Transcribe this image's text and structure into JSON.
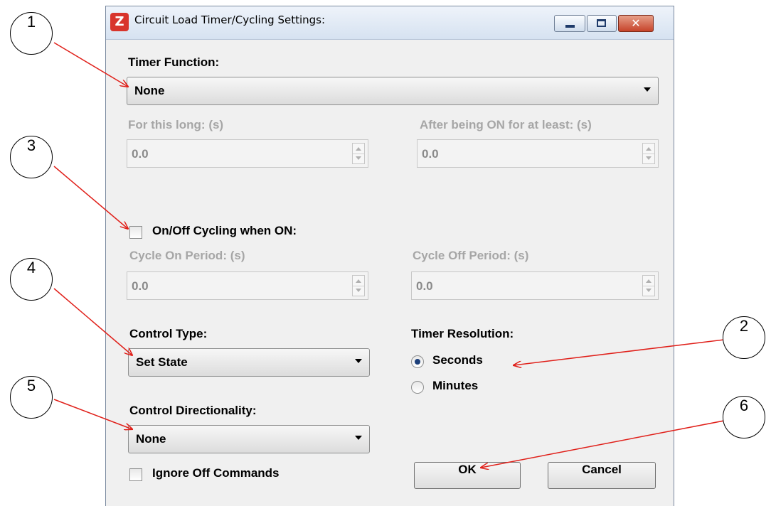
{
  "window": {
    "title": "Circuit Load Timer/Cycling Settings:",
    "app_icon": "Z",
    "controls": {
      "minimize": "minimize-icon",
      "maximize": "maximize-icon",
      "close": "✕"
    }
  },
  "timer_function": {
    "label": "Timer Function:",
    "value": "None"
  },
  "for_this_long": {
    "label": "For this long: (s)",
    "value": "0.0"
  },
  "after_on": {
    "label": "After being ON for at least: (s)",
    "value": "0.0"
  },
  "cycling": {
    "label": "On/Off Cycling when ON:",
    "checked": false
  },
  "cycle_on": {
    "label": "Cycle On Period: (s)",
    "value": "0.0"
  },
  "cycle_off": {
    "label": "Cycle Off Period: (s)",
    "value": "0.0"
  },
  "control_type": {
    "label": "Control Type:",
    "value": "Set State"
  },
  "timer_resolution": {
    "label": "Timer Resolution:",
    "options": [
      {
        "label": "Seconds",
        "selected": true
      },
      {
        "label": "Minutes",
        "selected": false
      }
    ]
  },
  "control_directionality": {
    "label": "Control Directionality:",
    "value": "None"
  },
  "ignore_off": {
    "label": "Ignore Off Commands",
    "checked": false
  },
  "buttons": {
    "ok": "OK",
    "cancel": "Cancel"
  },
  "callouts": [
    "1",
    "2",
    "3",
    "4",
    "5",
    "6"
  ],
  "colors": {
    "arrow": "#e0201a",
    "title_bar": "#dbe6f4",
    "dialog": "#f0f0f0",
    "disabled_text": "#a6a6a6"
  }
}
